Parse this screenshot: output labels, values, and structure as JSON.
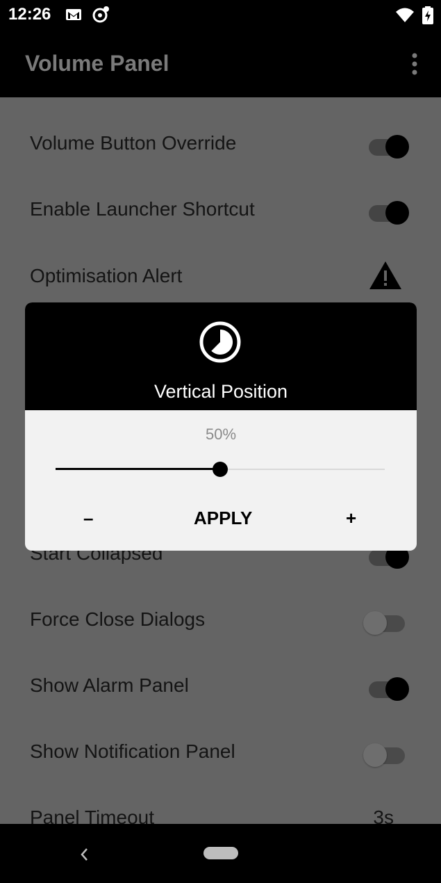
{
  "status_bar": {
    "time": "12:26",
    "icons": [
      "gmail-icon",
      "sync-icon",
      "wifi-icon",
      "battery-icon"
    ]
  },
  "app_bar": {
    "title": "Volume Panel",
    "menu_icon": "more-vert-icon"
  },
  "settings": [
    {
      "label": "Volume Button Override",
      "control": "switch",
      "on": true
    },
    {
      "label": "Enable Launcher Shortcut",
      "control": "switch",
      "on": true
    },
    {
      "label": "Optimisation Alert",
      "control": "warning-icon"
    },
    {
      "label": "Start Collapsed",
      "control": "switch",
      "on": true
    },
    {
      "label": "Force Close Dialogs",
      "control": "switch",
      "on": false
    },
    {
      "label": "Show Alarm Panel",
      "control": "switch",
      "on": true
    },
    {
      "label": "Show Notification Panel",
      "control": "switch",
      "on": false
    },
    {
      "label": "Panel Timeout",
      "control": "value",
      "value": "3s"
    }
  ],
  "dialog": {
    "icon": "timelapse-icon",
    "title": "Vertical Position",
    "value_text": "50%",
    "value": 0.5,
    "minus_label": "–",
    "apply_label": "APPLY",
    "plus_label": "+"
  },
  "nav_bar": {
    "back_icon": "back-chevron-icon",
    "home_icon": "home-pill-icon"
  }
}
